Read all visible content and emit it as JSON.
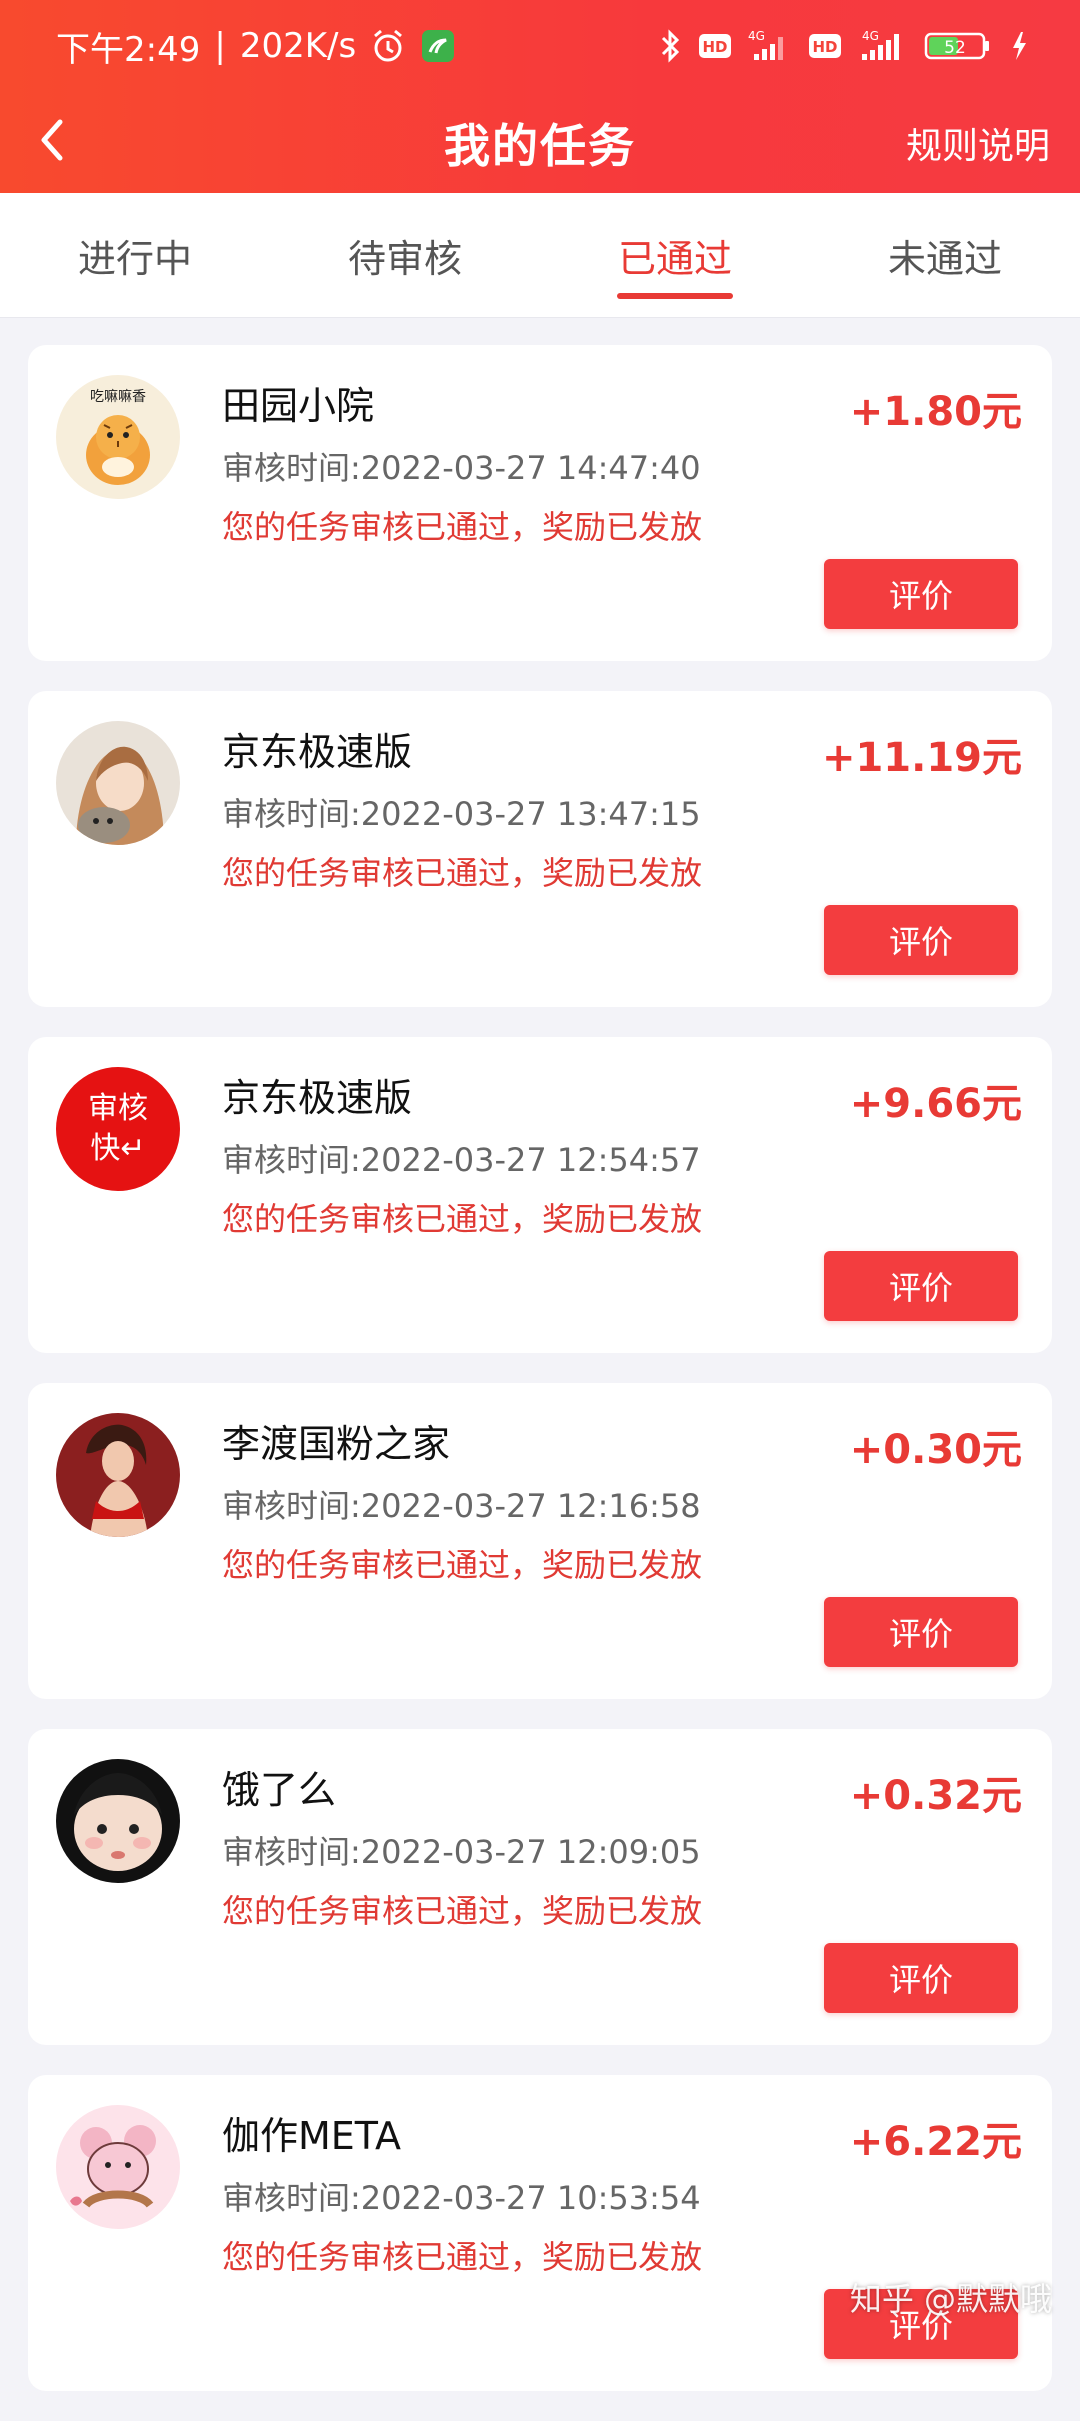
{
  "status_bar": {
    "time": "下午2:49",
    "net_speed": "202K/s",
    "battery": "52",
    "signal_1_type": "4G",
    "signal_2_type": "4G",
    "hd_1": "HD",
    "hd_2": "HD"
  },
  "header": {
    "title": "我的任务",
    "rules_label": "规则说明"
  },
  "tabs": [
    {
      "label": "进行中",
      "active": false
    },
    {
      "label": "待审核",
      "active": false
    },
    {
      "label": "已通过",
      "active": true
    },
    {
      "label": "未通过",
      "active": false
    }
  ],
  "tasks": [
    {
      "name": "田园小院",
      "time": "审核时间:2022-03-27 14:47:40",
      "message": "您的任务审核已通过，奖励已发放",
      "amount": "+1.80元",
      "button": "评价",
      "avatar_text": "吃嘛嘛香"
    },
    {
      "name": "京东极速版",
      "time": "审核时间:2022-03-27 13:47:15",
      "message": "您的任务审核已通过，奖励已发放",
      "amount": "+11.19元",
      "button": "评价"
    },
    {
      "name": "京东极速版",
      "time": "审核时间:2022-03-27 12:54:57",
      "message": "您的任务审核已通过，奖励已发放",
      "amount": "+9.66元",
      "button": "评价",
      "avatar_text_1": "审核",
      "avatar_text_2": "快↵"
    },
    {
      "name": "李渡国粉之家",
      "time": "审核时间:2022-03-27 12:16:58",
      "message": "您的任务审核已通过，奖励已发放",
      "amount": "+0.30元",
      "button": "评价"
    },
    {
      "name": "饿了么",
      "time": "审核时间:2022-03-27 12:09:05",
      "message": "您的任务审核已通过，奖励已发放",
      "amount": "+0.32元",
      "button": "评价"
    },
    {
      "name": "伽作META",
      "time": "审核时间:2022-03-27 10:53:54",
      "message": "您的任务审核已通过，奖励已发放",
      "amount": "+6.22元",
      "button": "评价"
    }
  ],
  "watermark": "知乎 @默默哦",
  "colors": {
    "brand_red": "#e83a35",
    "button_red": "#f33d3f",
    "header_gradient_start": "#f84a2e",
    "header_gradient_end": "#f63a42"
  }
}
